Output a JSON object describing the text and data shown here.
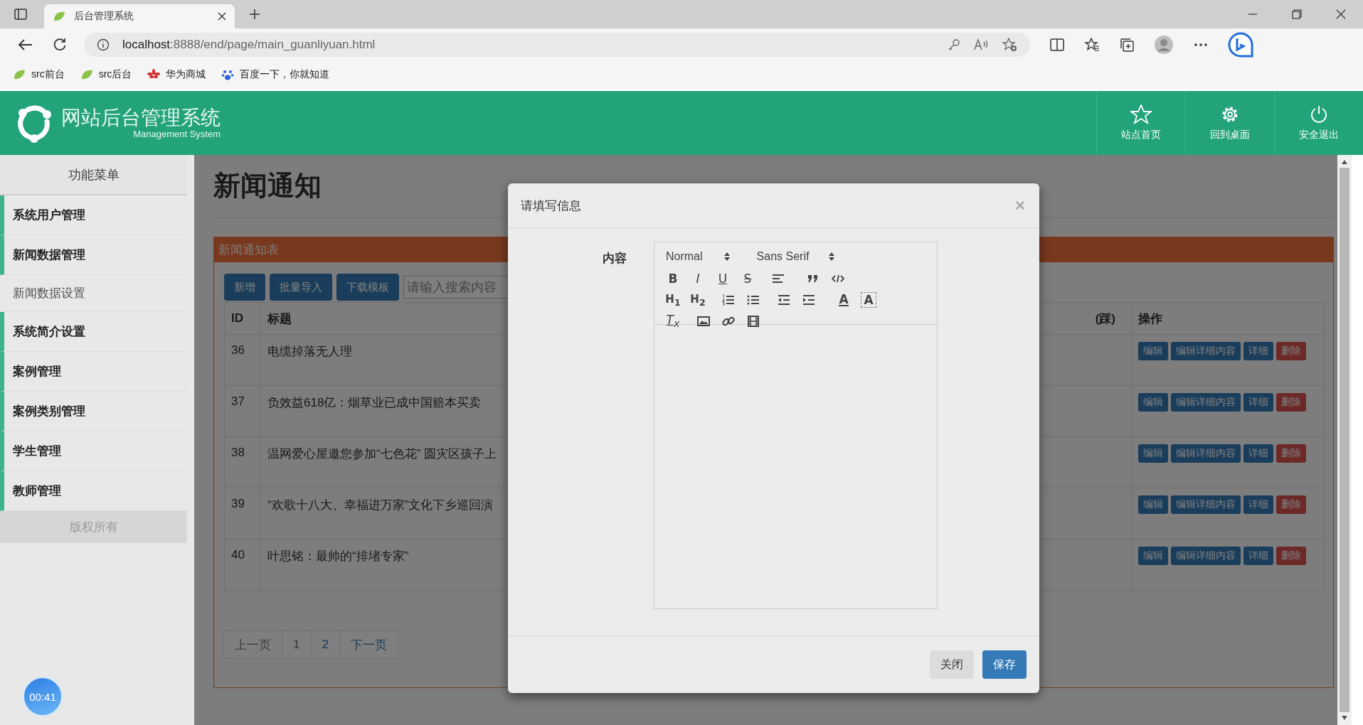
{
  "browser": {
    "tabs": [
      {
        "title": "后台管理系统",
        "selected": true
      }
    ],
    "url_host": "localhost",
    "url_rest": ":8888/end/page/main_guanliyuan.html",
    "bookmarks": [
      {
        "label": "src前台",
        "kind": "leaf"
      },
      {
        "label": "src后台",
        "kind": "leaf"
      },
      {
        "label": "华为商城",
        "kind": "flower"
      },
      {
        "label": "百度一下，你就知道",
        "kind": "paw"
      }
    ]
  },
  "header": {
    "title": "网站后台管理系统",
    "subtitle": "Management System",
    "nav": [
      {
        "label": "站点首页",
        "kind": "star"
      },
      {
        "label": "回到桌面",
        "kind": "gear"
      },
      {
        "label": "安全退出",
        "kind": "power"
      }
    ]
  },
  "sidebar": {
    "title": "功能菜单",
    "items": [
      {
        "label": "系统用户管理",
        "kind": "group"
      },
      {
        "label": "新闻数据管理",
        "kind": "group"
      },
      {
        "label": "新闻数据设置",
        "kind": "sub"
      },
      {
        "label": "系统简介设置",
        "kind": "group"
      },
      {
        "label": "案例管理",
        "kind": "group"
      },
      {
        "label": "案例类别管理",
        "kind": "group"
      },
      {
        "label": "学生管理",
        "kind": "group"
      },
      {
        "label": "教师管理",
        "kind": "group"
      }
    ],
    "footer": "版权所有"
  },
  "page": {
    "title": "新闻通知",
    "panel_title": "新闻通知表",
    "buttons": [
      "新增",
      "批量导入",
      "下载模板"
    ],
    "search": {
      "placeholder": "请输入搜索内容"
    },
    "columns": [
      "ID",
      "标题",
      "(踩)",
      "操作"
    ],
    "rows": [
      {
        "id": "36",
        "title": "电缆掉落无人理",
        "actions": [
          {
            "label": "编辑",
            "kind": "primary"
          },
          {
            "label": "编辑详细内容",
            "kind": "primary"
          },
          {
            "label": "详细",
            "kind": "primary"
          },
          {
            "label": "删除",
            "kind": "danger"
          }
        ]
      },
      {
        "id": "37",
        "title": "负效益618亿：烟草业已成中国赔本买卖",
        "actions": [
          {
            "label": "编辑",
            "kind": "primary"
          },
          {
            "label": "编辑详细内容",
            "kind": "primary"
          },
          {
            "label": "详细",
            "kind": "primary"
          },
          {
            "label": "删除",
            "kind": "danger"
          }
        ]
      },
      {
        "id": "38",
        "title": "温网爱心屋邀您参加“七色花” 圆灾区孩子上",
        "actions": [
          {
            "label": "编辑",
            "kind": "primary"
          },
          {
            "label": "编辑详细内容",
            "kind": "primary"
          },
          {
            "label": "详细",
            "kind": "primary"
          },
          {
            "label": "删除",
            "kind": "danger"
          }
        ]
      },
      {
        "id": "39",
        "title": "“欢歌十八大、幸福进万家”文化下乡巡回演",
        "actions": [
          {
            "label": "编辑",
            "kind": "primary"
          },
          {
            "label": "编辑详细内容",
            "kind": "primary"
          },
          {
            "label": "详细",
            "kind": "primary"
          },
          {
            "label": "删除",
            "kind": "danger"
          }
        ]
      },
      {
        "id": "40",
        "title": "叶思铭：最帅的“排堵专家”",
        "actions": [
          {
            "label": "编辑",
            "kind": "primary"
          },
          {
            "label": "编辑详细内容",
            "kind": "primary"
          },
          {
            "label": "详细",
            "kind": "primary"
          },
          {
            "label": "删除",
            "kind": "danger"
          }
        ]
      }
    ],
    "pagination": [
      {
        "label": "上一页",
        "disabled": true
      },
      {
        "label": "1",
        "disabled": true
      },
      {
        "label": "2",
        "disabled": false
      },
      {
        "label": "下一页",
        "disabled": false
      }
    ]
  },
  "modal": {
    "title": "请填写信息",
    "close": "×",
    "field_label": "内容",
    "selects": [
      "Normal",
      "Sans Serif"
    ],
    "toolbar": [
      [
        {
          "kind": "bold",
          "label": "B"
        },
        {
          "kind": "italic",
          "label": "I"
        },
        {
          "kind": "underline",
          "label": "U"
        },
        {
          "kind": "strike",
          "label": "S"
        },
        {
          "kind": "align"
        },
        {
          "kind": "blockquote"
        },
        {
          "kind": "code"
        }
      ],
      [
        {
          "kind": "h1",
          "label": "H$_{1}$"
        },
        {
          "kind": "h2",
          "label": "H$_{2}$"
        },
        {
          "kind": "ol"
        },
        {
          "kind": "ul"
        },
        {
          "kind": "outdent"
        },
        {
          "kind": "indent"
        },
        {
          "kind": "color",
          "label": "A"
        },
        {
          "kind": "background",
          "label": "A"
        }
      ],
      [
        {
          "kind": "clean",
          "label": "T$_{x}$"
        },
        {
          "kind": "image"
        },
        {
          "kind": "link"
        },
        {
          "kind": "video"
        }
      ]
    ],
    "buttons": [
      {
        "label": "关闭",
        "kind": "default"
      },
      {
        "label": "保存",
        "kind": "primary"
      }
    ]
  },
  "timer": "00:41"
}
